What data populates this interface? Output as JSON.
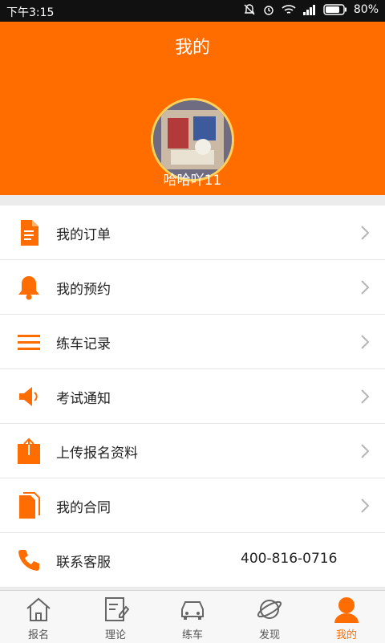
{
  "status_bar": {
    "time": "下午3:15",
    "battery": "80%"
  },
  "header": {
    "title": "我的",
    "username": "哈哈吖11"
  },
  "menu": {
    "items": [
      {
        "label": "我的订单",
        "icon": "document-icon"
      },
      {
        "label": "我的预约",
        "icon": "bell-icon"
      },
      {
        "label": "练车记录",
        "icon": "list-icon"
      },
      {
        "label": "考试通知",
        "icon": "speaker-icon"
      },
      {
        "label": "上传报名资料",
        "icon": "upload-icon"
      },
      {
        "label": "我的合同",
        "icon": "contract-icon"
      },
      {
        "label": "联系客服",
        "icon": "phone-icon",
        "value": "400-816-0716"
      }
    ]
  },
  "tabbar": {
    "tabs": [
      {
        "label": "报名",
        "icon": "home-icon"
      },
      {
        "label": "理论",
        "icon": "edit-icon"
      },
      {
        "label": "练车",
        "icon": "car-icon"
      },
      {
        "label": "发现",
        "icon": "planet-icon"
      },
      {
        "label": "我的",
        "icon": "user-icon",
        "active": true
      }
    ]
  },
  "colors": {
    "accent": "#ff6d00",
    "avatar_ring": "#ffd15c"
  }
}
